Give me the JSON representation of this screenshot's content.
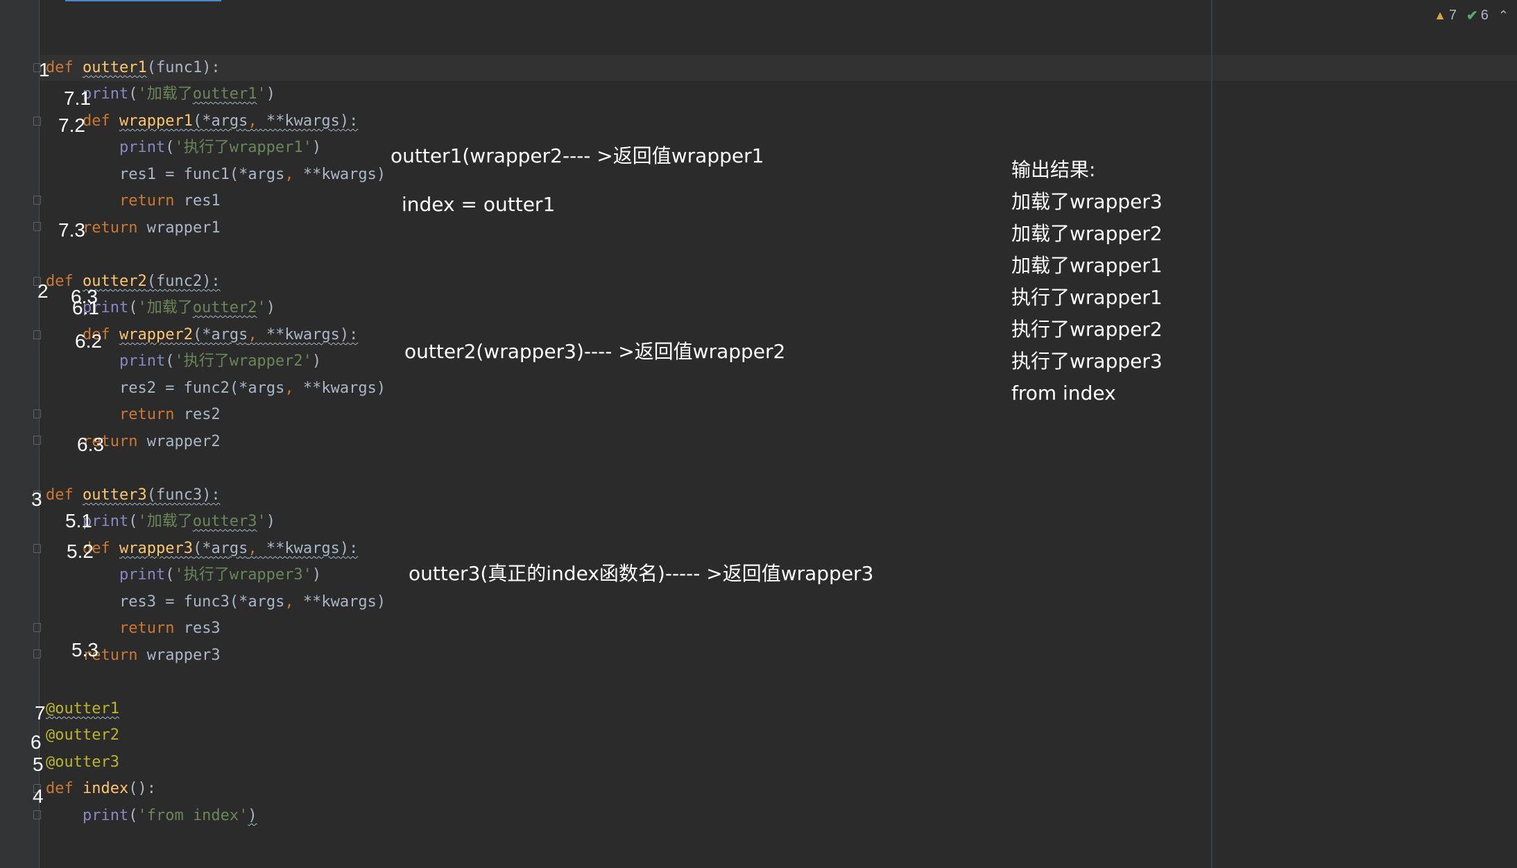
{
  "status": {
    "warnings": "7",
    "checks": "6",
    "icons": [
      "warning-triangle-icon",
      "check-icon",
      "chevron-up-icon"
    ]
  },
  "code": {
    "line1_def": "def",
    "line1_name": "outter1",
    "line1_rest": "(func1):",
    "line2_print": "print",
    "line2_open": "(",
    "line2_str_a": "'加载了",
    "line2_str_b": "outter1",
    "line2_str_c": "'",
    "line2_close": ")",
    "line3_def": "def",
    "line3_name": "wrapper1",
    "line3_args": "(*args",
    "line3_comma": ",",
    "line3_kwargs": " **kwargs):",
    "line4_print": "print",
    "line4_open": "(",
    "line4_str": "'执行了wrapper1'",
    "line4_close": ")",
    "line5_text": "res1 = func1(*args",
    "line5_comma": ",",
    "line5_end": " **kwargs)",
    "line6_ret": "return",
    "line6_val": " res1",
    "line7_ret": "return",
    "line7_val": " wrapper1",
    "line8_def": "def",
    "line8_name": "outter2",
    "line8_rest": "(func2):",
    "line9_print": "print",
    "line9_open": "(",
    "line9_str_a": "'加载了",
    "line9_str_b": "outter2",
    "line9_str_c": "'",
    "line9_close": ")",
    "line10_def": "def",
    "line10_name": "wrapper2",
    "line10_args": "(*args",
    "line10_comma": ",",
    "line10_kwargs": " **kwargs):",
    "line11_print": "print",
    "line11_open": "(",
    "line11_str": "'执行了wrapper2'",
    "line11_close": ")",
    "line12_text": "res2 = func2(*args",
    "line12_comma": ",",
    "line12_end": " **kwargs)",
    "line13_ret": "return",
    "line13_val": " res2",
    "line14_ret": "return",
    "line14_val": " wrapper2",
    "line15_def": "def",
    "line15_name": "outter3",
    "line15_rest": "(func3):",
    "line16_print": "print",
    "line16_open": "(",
    "line16_str_a": "'加载了",
    "line16_str_b": "outter3",
    "line16_str_c": "'",
    "line16_close": ")",
    "line17_def": "def",
    "line17_name": "wrapper3",
    "line17_args": "(*args",
    "line17_comma": ",",
    "line17_kwargs": " **kwargs):",
    "line18_print": "print",
    "line18_open": "(",
    "line18_str": "'执行了wrapper3'",
    "line18_close": ")",
    "line19_text": "res3 = func3(*args",
    "line19_comma": ",",
    "line19_end": " **kwargs)",
    "line20_ret": "return",
    "line20_val": " res3",
    "line21_ret": "return",
    "line21_val": " wrapper3",
    "line22_deco": "@outter1",
    "line23_deco": "@outter2",
    "line24_deco": "@outter3",
    "line25_def": "def",
    "line25_name": "index",
    "line25_rest": "():",
    "line26_print": "print",
    "line26_open": "(",
    "line26_str": "'from index'",
    "line26_close": ")"
  },
  "step_labels": {
    "s1": "1",
    "s7_1": "7.1",
    "s7_2": "7.2",
    "s7_3": "7.3",
    "s2": "2",
    "s6_3_top": "6.3",
    "s6_1": "6.1",
    "s6_2": "6.2",
    "s6_3": "6.3",
    "s3": "3",
    "s5_1": "5.1",
    "s5_2": "5.2",
    "s5_3": "5.3",
    "s7": "7",
    "s6": "6",
    "s5": "5",
    "s4": "4"
  },
  "annotations": {
    "a1": "outter1(wrapper2---- >返回值wrapper1",
    "a2": "index = outter1",
    "a3": "outter2(wrapper3)---- >返回值wrapper2",
    "a4": "outter3(真正的index函数名)----- >返回值wrapper3"
  },
  "output": {
    "title": "输出结果:",
    "lines": [
      "加载了wrapper3",
      "加载了wrapper2",
      "加载了wrapper1",
      "执行了wrapper1",
      "执行了wrapper2",
      "执行了wrapper3",
      "from index"
    ]
  }
}
